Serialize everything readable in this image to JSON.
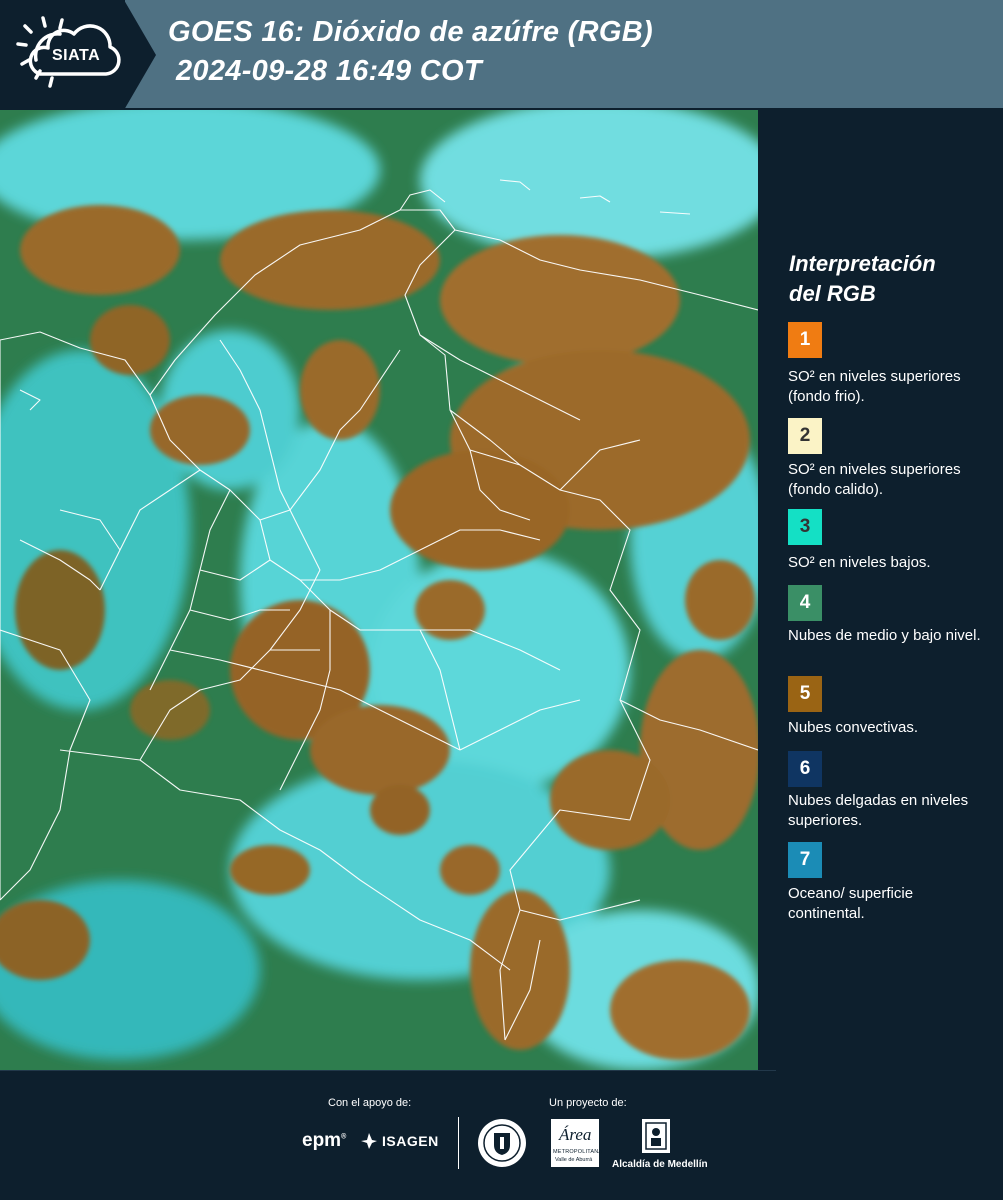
{
  "header": {
    "logo_text": "SIATA",
    "title_line1": "GOES 16: Dióxido de azúfre (RGB)",
    "title_line2": "2024-09-28 16:49 COT"
  },
  "map": {
    "description_icon": "satellite-map",
    "colors": {
      "background": "#2a7a55",
      "surface": "#2fc9cf",
      "surface_light": "#8fe8ec",
      "convective": "#9a6a2c",
      "border_lines": "#ffffff"
    }
  },
  "legend": {
    "title_line1": "Interpretación",
    "title_line2": "del RGB",
    "items": [
      {
        "num": "1",
        "color": "#f07c12",
        "text_color": "#ffffff",
        "text": "SO² en niveles superiores (fondo frio)."
      },
      {
        "num": "2",
        "color": "#fbf3c6",
        "text_color": "#333333",
        "text": "SO² en niveles superiores (fondo calido)."
      },
      {
        "num": "3",
        "color": "#14e0c5",
        "text_color": "#333333",
        "text": "SO² en niveles bajos."
      },
      {
        "num": "4",
        "color": "#3a8f66",
        "text_color": "#ffffff",
        "text": "Nubes de medio y bajo nivel."
      },
      {
        "num": "5",
        "color": "#9a6414",
        "text_color": "#ffffff",
        "text": "Nubes convectivas."
      },
      {
        "num": "6",
        "color": "#0f3562",
        "text_color": "#ffffff",
        "text": "Nubes delgadas en niveles superiores."
      },
      {
        "num": "7",
        "color": "#1b8cb6",
        "text_color": "#ffffff",
        "text": "Oceano/ superficie continental."
      }
    ]
  },
  "footer": {
    "support_label": "Con el apoyo de:",
    "project_label": "Un proyecto de:",
    "epm": "epm",
    "isagen": "ISAGEN",
    "area_text": "Área",
    "area_sub": "METROPOLITANA",
    "area_sub2": "Valle de Aburrá",
    "alcaldia": "Alcaldía de Medellín"
  }
}
